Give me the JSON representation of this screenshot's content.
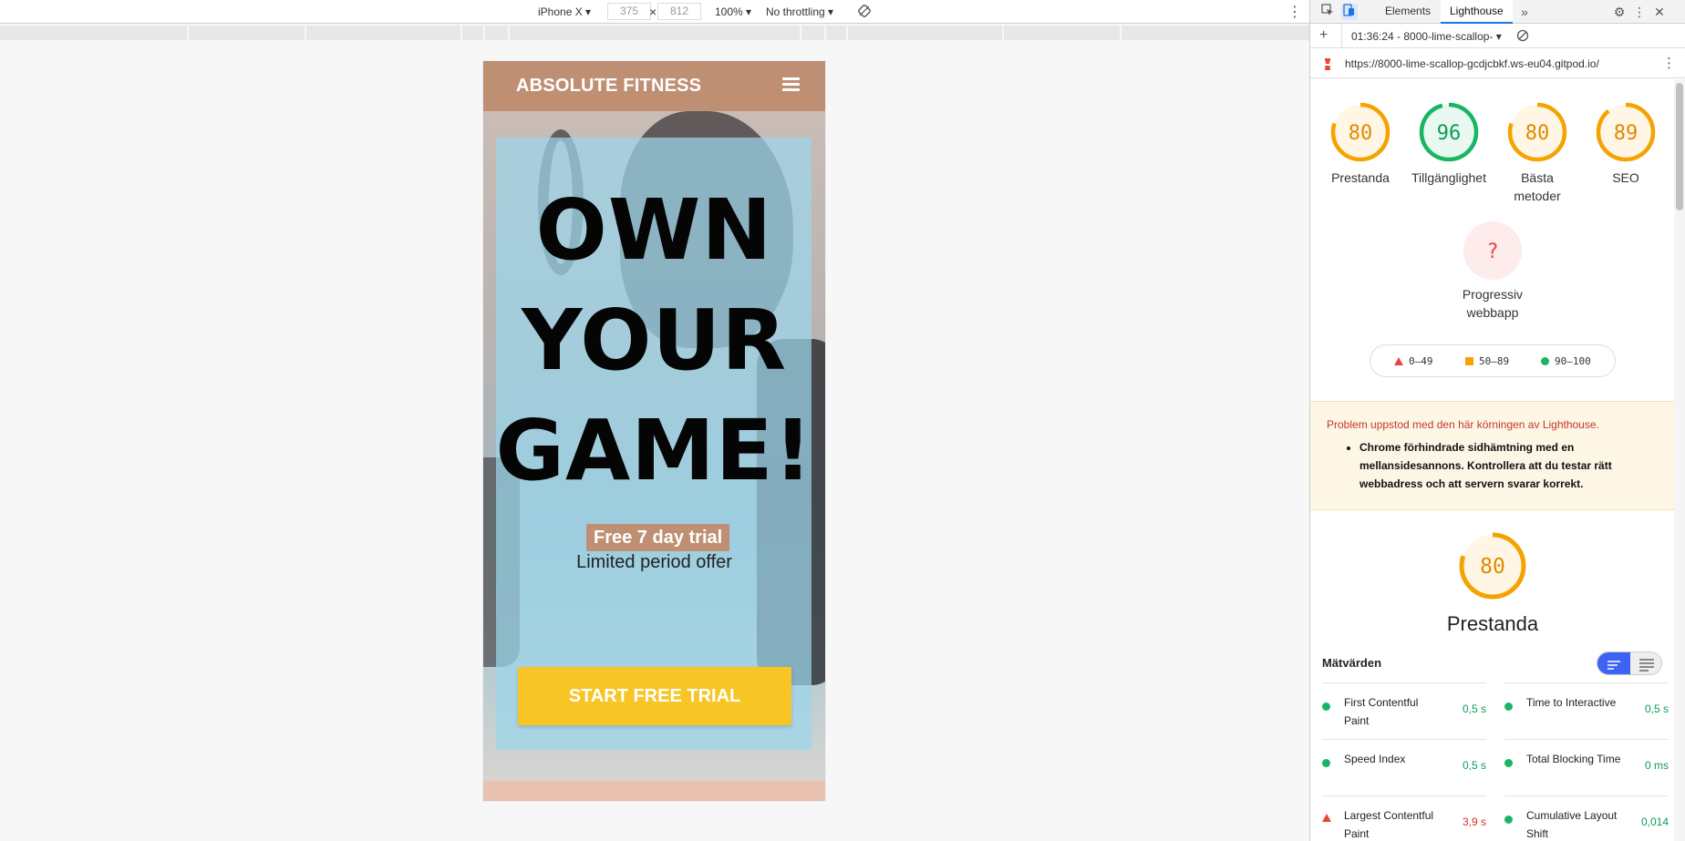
{
  "device_toolbar": {
    "device": "iPhone X",
    "width": "375",
    "height": "812",
    "zoom": "100%",
    "throttling": "No throttling"
  },
  "site": {
    "brand": "ABSOLUTE FITNESS",
    "headline": [
      "OWN",
      "YOUR",
      "GAME!"
    ],
    "trial_badge": "Free 7 day trial",
    "offer": "Limited period offer",
    "cta": "START FREE TRIAL"
  },
  "devtools": {
    "tabs": [
      "Elements",
      "Lighthouse"
    ],
    "active_tab": "Lighthouse",
    "report_select": "01:36:24 - 8000-lime-scallop-",
    "url": "https://8000-lime-scallop-gcdjcbkf.ws-eu04.gitpod.io/"
  },
  "lighthouse": {
    "categories": [
      {
        "name": "Prestanda",
        "score": "80",
        "color": "#f4a300",
        "value": 0.8
      },
      {
        "name": "Tillgänglighet",
        "score": "96",
        "color": "#18b663",
        "value": 0.96
      },
      {
        "name": "Bästa metoder",
        "score": "80",
        "color": "#f4a300",
        "value": 0.8
      },
      {
        "name": "SEO",
        "score": "89",
        "color": "#f4a300",
        "value": 0.89
      }
    ],
    "pwa": {
      "name": "Progressiv webbapp",
      "symbol": "?"
    },
    "legend": [
      "0–49",
      "50–89",
      "90–100"
    ],
    "warning": {
      "title": "Problem uppstod med den här körningen av Lighthouse.",
      "item": "Chrome förhindrade sidhämtning med en mellansidesannons. Kontrollera att du testar rätt webbadress och att servern svarar korrekt."
    },
    "performance": {
      "title": "Prestanda",
      "score": "80",
      "value": 0.8
    },
    "metrics_title": "Mätvärden",
    "metrics": [
      {
        "name": "First Contentful Paint",
        "value": "0,5 s",
        "status": "pass"
      },
      {
        "name": "Time to Interactive",
        "value": "0,5 s",
        "status": "pass"
      },
      {
        "name": "Speed Index",
        "value": "0,5 s",
        "status": "pass"
      },
      {
        "name": "Total Blocking Time",
        "value": "0 ms",
        "status": "pass"
      },
      {
        "name": "Largest Contentful Paint",
        "value": "3,9 s",
        "status": "fail"
      },
      {
        "name": "Cumulative Layout Shift",
        "value": "0,014",
        "status": "pass"
      }
    ]
  }
}
